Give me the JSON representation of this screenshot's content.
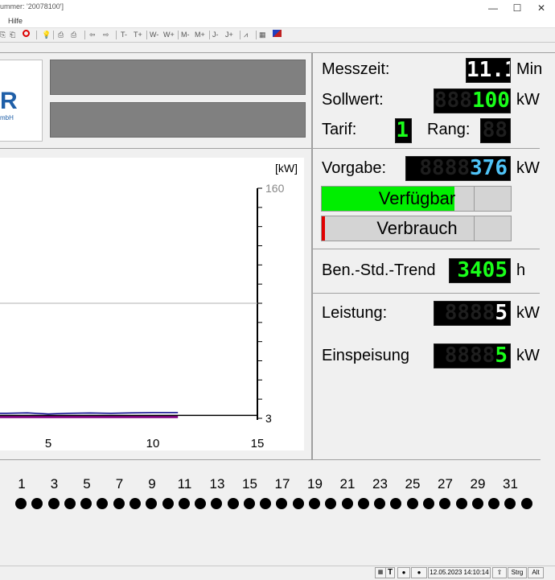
{
  "window": {
    "title": "ummer: '20078100']",
    "minimize": "—",
    "maximize": "☐",
    "close": "✕"
  },
  "menu": {
    "help": "Hilfe"
  },
  "toolbar": {
    "t_minus": "T-",
    "t_plus": "T+",
    "w_minus": "W-",
    "w_plus": "W+",
    "m_minus": "M-",
    "m_plus": "M+",
    "j_minus": "J-",
    "j_plus": "J+",
    "icons": [
      "copy-icon",
      "copy2-icon",
      "stop-icon",
      "bulb-icon",
      "print-icon",
      "print2-icon",
      "arrow-left-icon",
      "arrow-right-icon",
      "chart-icon",
      "grid-icon",
      "graph-icon"
    ]
  },
  "logo": {
    "letter": "R",
    "sub": "mbH"
  },
  "measure": {
    "messzeit_label": "Messzeit:",
    "messzeit_value": "11.1",
    "messzeit_unit": "Min",
    "sollwert_label": "Sollwert:",
    "sollwert_ghost": "888",
    "sollwert_value": "100",
    "sollwert_unit": "kW",
    "tarif_label": "Tarif:",
    "tarif_value": "1",
    "rang_label": "Rang:",
    "rang_ghost": "88",
    "vorgabe_label": "Vorgabe:",
    "vorgabe_ghost": "8888",
    "vorgabe_value": "376",
    "vorgabe_unit": "kW",
    "verfuegbar_label": "Verfügbar",
    "verfuegbar_fraction": 0.7,
    "verbrauch_label": "Verbrauch",
    "verbrauch_fraction": 0.02,
    "trend_label": "Ben.-Std.-Trend",
    "trend_value": "3405",
    "trend_unit": "h",
    "leistung_label": "Leistung:",
    "leistung_ghost": "8888",
    "leistung_value": "5",
    "leistung_unit": "kW",
    "einspeisung_label": "Einspeisung",
    "einspeisung_ghost": "8888",
    "einspeisung_value": "5",
    "einspeisung_unit": "kW"
  },
  "chart_data": {
    "type": "line",
    "ylabel": "[kW]",
    "y_ticks": [
      "160",
      "3"
    ],
    "x_ticks": [
      "5",
      "10",
      "15"
    ],
    "xlim": [
      0,
      15
    ],
    "ylim": [
      0,
      160
    ],
    "reference_line": 80,
    "series": [
      {
        "color": "#00008b",
        "x": [
          0,
          1.5,
          3,
          4,
          5,
          6,
          7,
          8,
          9,
          10,
          11.2
        ],
        "y": [
          4,
          3.5,
          3.5,
          3.8,
          3,
          3.5,
          3.7,
          3.5,
          3.8,
          4,
          4
        ]
      },
      {
        "color": "#800080",
        "x": [
          0,
          3,
          5,
          7,
          8,
          10,
          11.2
        ],
        "y": [
          1,
          1,
          1,
          1,
          1,
          1,
          1
        ]
      },
      {
        "color": "#000000",
        "x": [
          0,
          15
        ],
        "y": [
          2,
          2
        ]
      }
    ]
  },
  "days": [
    "1",
    "3",
    "5",
    "7",
    "9",
    "11",
    "13",
    "15",
    "17",
    "19",
    "21",
    "23",
    "25",
    "27",
    "29",
    "31"
  ],
  "dots_count": 32,
  "status": {
    "date_time": "12.05.2023 14:10:14",
    "strg": "Strg",
    "alt": "Alt",
    "t_label": "T"
  }
}
